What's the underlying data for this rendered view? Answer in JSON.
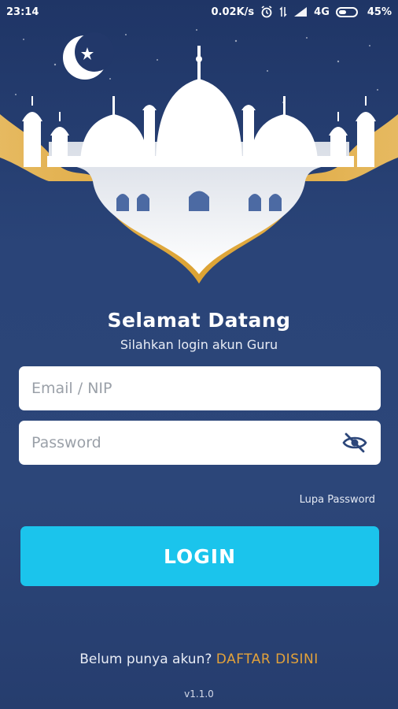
{
  "status_bar": {
    "time": "23:14",
    "speed": "0.02K/s",
    "network": "4G",
    "battery": "45%",
    "battery_level": 0.45
  },
  "welcome": {
    "title": "Selamat Datang",
    "subtitle": "Silahkan login akun Guru"
  },
  "form": {
    "email_placeholder": "Email / NIP",
    "email_value": "",
    "password_placeholder": "Password",
    "password_value": "",
    "forgot_label": "Lupa Password",
    "login_label": "LOGIN"
  },
  "register": {
    "question": "Belum punya akun?",
    "link": "DAFTAR DISINI"
  },
  "version": "v1.1.0",
  "colors": {
    "background": "#2a4478",
    "accent": "#1bc4ec",
    "gold": "#e3a23a",
    "eye_icon": "#2c4679"
  },
  "icons": [
    "alarm-icon",
    "signal-icon",
    "battery-icon",
    "eye-off-icon",
    "crescent-moon-icon",
    "mosque-illustration"
  ]
}
